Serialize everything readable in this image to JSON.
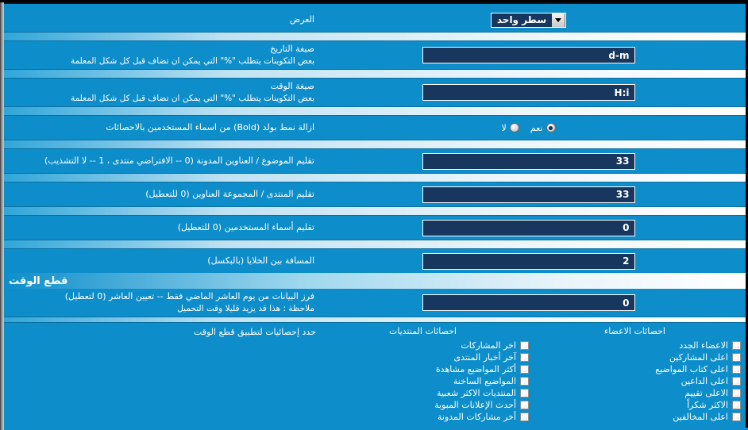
{
  "rows": {
    "display": {
      "label": "العرض",
      "select_value": "سطر واحد",
      "arrow_icon": "chevron-down-icon"
    },
    "date_format": {
      "label": "صيغة التاريخ",
      "sub": "بعض التكوينات يتطلب  \"%\"  التي يمكن ان تضاف قبل كل شكل المعلمة",
      "value": "d-m"
    },
    "time_format": {
      "label": "صيغة الوقت",
      "sub": "بعض التكوينات يتطلب  \"%\"  التي يمكن ان تضاف قبل كل شكل المعلمة",
      "value": "H:i"
    },
    "bold_removal": {
      "label": "ازالة نمط بولد (Bold) من اسماء المستخدمين بالاحصائات",
      "options": [
        {
          "label": "نعم",
          "selected": true
        },
        {
          "label": "لا",
          "selected": false
        }
      ]
    },
    "trim_thread": {
      "label": "تقليم الموضوع / العناوين المدونة (0 -- الافتراضي منتدى ، 1 -- لا التشذيب)",
      "value": "33"
    },
    "trim_forum": {
      "label": "تقليم المنتدى / المجموعة العناوين (0 للتعطيل)",
      "value": "33"
    },
    "trim_username": {
      "label": "تقليم أسماء المستخدمين (0 للتعطيل)",
      "value": "0"
    },
    "cellspacing": {
      "label": "المسافة بين الخلايا (بالبكسل)",
      "value": "2"
    }
  },
  "timecut_section": {
    "title": "قطع الوقت",
    "sort": {
      "label": "فرز البيانات من يوم العاشر الماضي فقط -- تعيين العاشر (0 لتعطيل)",
      "sub": "ملاحظة : هذا قد يزيد قليلا وقت التحميل",
      "value": "0"
    },
    "stats": {
      "label": "حدد إحصائيات لتطبيق قطع الوقت",
      "columns": [
        {
          "head": "احصائات الاعضاء",
          "items": [
            {
              "label": "الاعضاء الجدد",
              "checked": false
            },
            {
              "label": "اعلى المشاركين",
              "checked": false
            },
            {
              "label": "اعلى كتاب المواضيع",
              "checked": false
            },
            {
              "label": "اعلى الداعين",
              "checked": false
            },
            {
              "label": "الاعلى تقييم",
              "checked": false
            },
            {
              "label": "الاكثر شكراً",
              "checked": false
            },
            {
              "label": "اعلى المخالفين",
              "checked": false
            }
          ]
        },
        {
          "head": "احصائات المنتديات",
          "items": [
            {
              "label": "اخر المشاركات",
              "checked": false
            },
            {
              "label": "آخر أخبار المنتدى",
              "checked": false
            },
            {
              "label": "أكثر المواضيع مشاهدة",
              "checked": false
            },
            {
              "label": "المواضيع الساخنة",
              "checked": false
            },
            {
              "label": "المنتديات الاكثر شعبية",
              "checked": false
            },
            {
              "label": "أحدث الإعلانات المبوبة",
              "checked": false
            },
            {
              "label": "أخر مشاركات المدونة",
              "checked": false
            }
          ]
        }
      ]
    }
  },
  "colors": {
    "page_bg": "#0d8ecb",
    "input_bg": "#17375e",
    "text": "#ffffff"
  }
}
